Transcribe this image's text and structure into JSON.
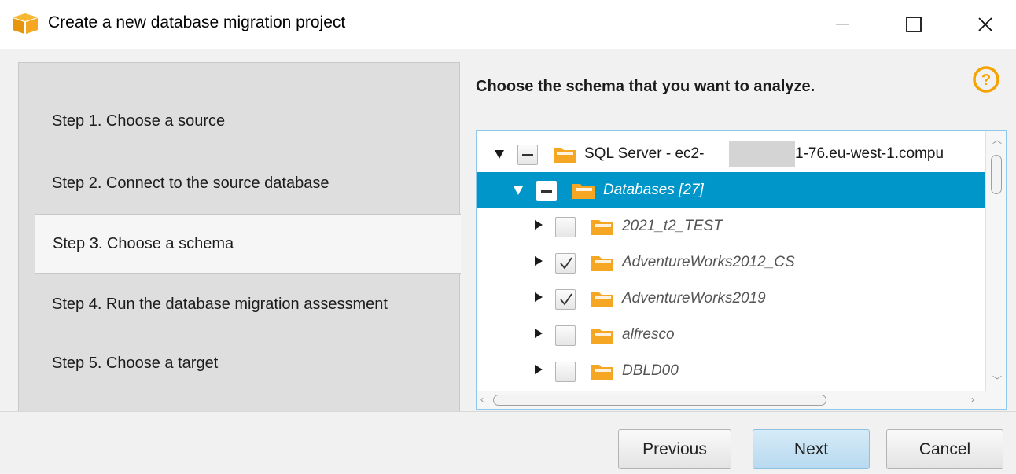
{
  "window": {
    "title": "Create a new database migration project",
    "icon": "aws-cube-icon",
    "controls": [
      "minimize-icon",
      "maximize-icon",
      "close-icon"
    ]
  },
  "steps": [
    {
      "label": "Step 1. Choose a source",
      "active": false
    },
    {
      "label": "Step 2. Connect to the source database",
      "active": false
    },
    {
      "label": "Step 3. Choose a schema",
      "active": true
    },
    {
      "label": "Step 4. Run the database migration assessment",
      "active": false
    },
    {
      "label": "Step 5. Choose a target",
      "active": false
    }
  ],
  "content": {
    "heading": "Choose the schema that you want to analyze.",
    "help_icon": "help-icon"
  },
  "tree": {
    "root": {
      "label_prefix": "SQL Server - ec2-",
      "label_suffix": "1-76.eu-west-1.compu",
      "state": "partial",
      "expanded": true
    },
    "group": {
      "label": "Databases [27]",
      "state": "partial",
      "expanded": true,
      "selected": true
    },
    "items": [
      {
        "label": "2021_t2_TEST",
        "checked": false
      },
      {
        "label": "AdventureWorks2012_CS",
        "checked": true
      },
      {
        "label": "AdventureWorks2019",
        "checked": true
      },
      {
        "label": "alfresco",
        "checked": false
      },
      {
        "label": "DBLD00",
        "checked": false
      }
    ]
  },
  "buttons": {
    "previous": "Previous",
    "next": "Next",
    "cancel": "Cancel"
  },
  "colors": {
    "selection": "#0096c9",
    "folder": "#f5a623",
    "help": "#f5a300",
    "next_button": "#c4e1f3"
  }
}
